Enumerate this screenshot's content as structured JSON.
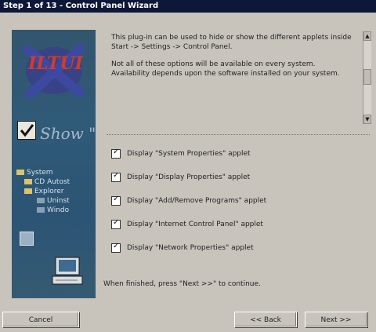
{
  "window": {
    "title": "Step 1 of 13 - Control Panel Wizard"
  },
  "art": {
    "logo_text": "ILTUI",
    "check_caption": "Show \"",
    "tree": [
      {
        "label": "System"
      },
      {
        "label": "CD Autost"
      },
      {
        "label": "Explorer"
      },
      {
        "label": "Uninst"
      },
      {
        "label": "Windo"
      }
    ]
  },
  "intro": {
    "line1": "This plug-in can be used to hide or show the different applets inside Start -> Settings -> Control Panel.",
    "line2": "Not all of these options will be available on every system. Availability depends upon the software installed on your system."
  },
  "options": [
    {
      "label": "Display \"System Properties\" applet",
      "checked": true
    },
    {
      "label": "Display \"Display Properties\" applet",
      "checked": true
    },
    {
      "label": "Display \"Add/Remove Programs\" applet",
      "checked": true
    },
    {
      "label": "Display \"Internet Control Panel\" applet",
      "checked": true
    },
    {
      "label": "Display \"Network Properties\" applet",
      "checked": true
    }
  ],
  "footer": {
    "finish_text": "When finished, press \"Next >>\" to continue."
  },
  "buttons": {
    "cancel": "Cancel",
    "back": "<< Back",
    "next": "Next >>"
  },
  "colors": {
    "titlebar": "#0d1838",
    "panel": "#c8c4bc",
    "art": "#2f5a78"
  }
}
